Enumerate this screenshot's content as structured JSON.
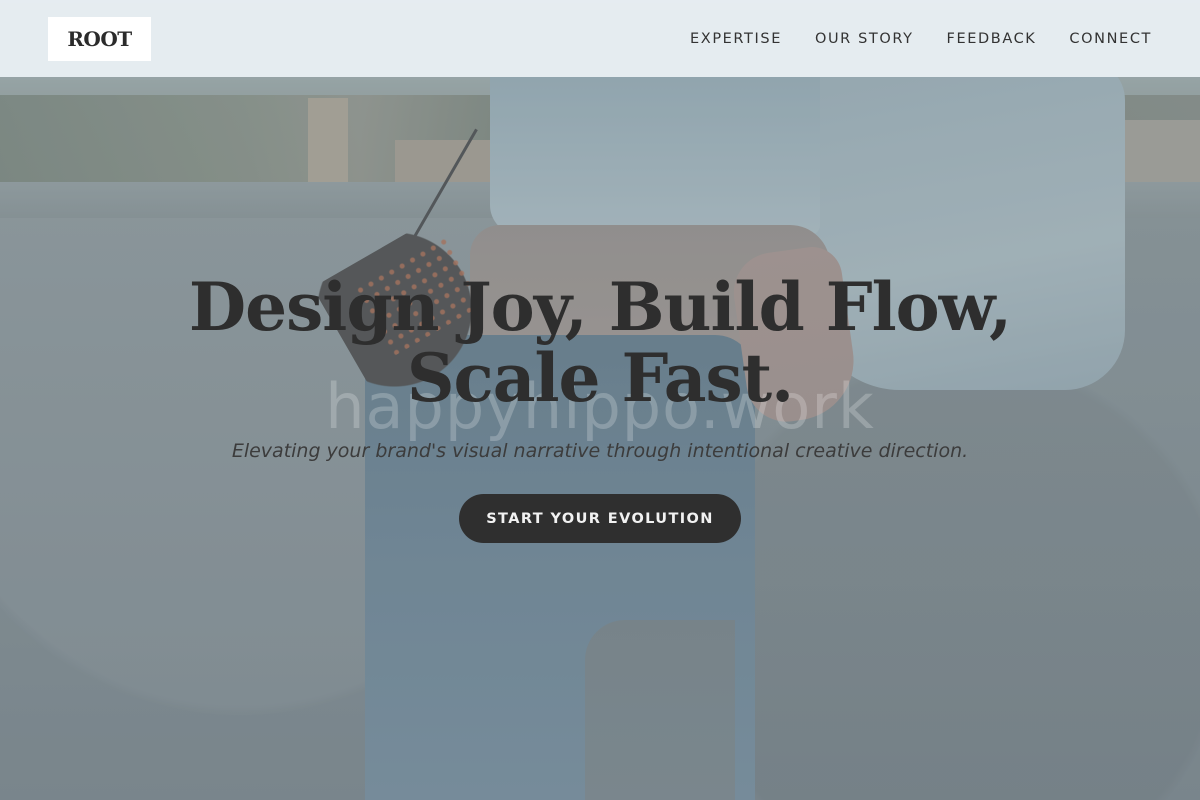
{
  "header": {
    "logo": "ROOT",
    "nav": [
      {
        "label": "EXPERTISE"
      },
      {
        "label": "OUR STORY"
      },
      {
        "label": "FEEDBACK"
      },
      {
        "label": "CONNECT"
      }
    ]
  },
  "hero": {
    "headline_line1": "Design Joy, Build Flow,",
    "headline_line2": "Scale Fast.",
    "watermark": "happyhippo.work",
    "subheadline": "Elevating your brand's visual narrative through intentional creative direction.",
    "cta_label": "START YOUR EVOLUTION"
  },
  "colors": {
    "header_bg": "#e8eef2",
    "text_dark": "#2e2e2e",
    "cta_bg": "#2f2f2f",
    "cta_text": "#f2f2f2"
  }
}
